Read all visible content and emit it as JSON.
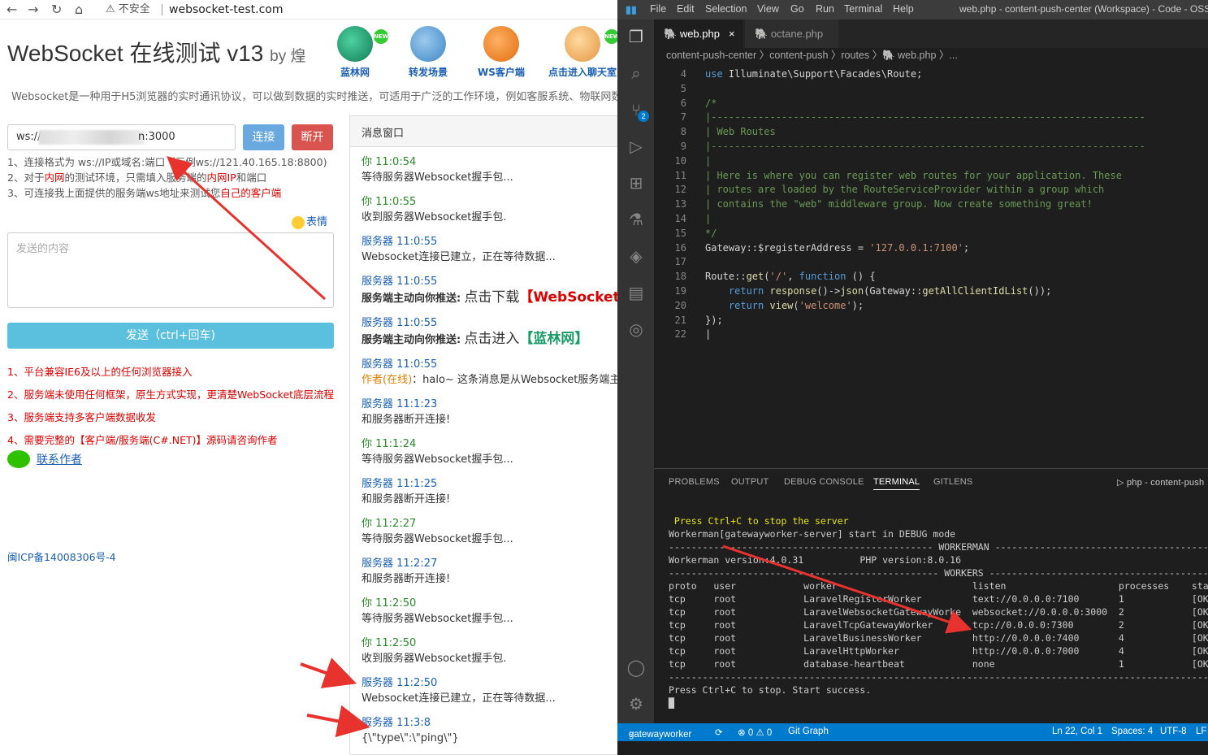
{
  "browser": {
    "warn_label": "不安全",
    "url": "websocket-test.com"
  },
  "page": {
    "title": "WebSocket 在线测试 v13",
    "by": "by 煌",
    "nav": [
      {
        "label": "蓝林网",
        "color": "#1a9c6a"
      },
      {
        "label": "转发场景",
        "color": "#5a9fd4"
      },
      {
        "label": "WS客户端",
        "color": "#f08c2c"
      },
      {
        "label": "点击进入聊天室",
        "color": "#f5c46a"
      }
    ],
    "badge": "NEW",
    "intro": "Websocket是一种用于H5浏览器的实时通讯协议，可以做到数据的实时推送，可适用于广泛的工作环境，例如客服系统、物联网数",
    "ws_prefix": "ws://",
    "ws_suffix": "n:3000",
    "connect_label": "连接",
    "disconnect_label": "断开",
    "tips": {
      "t1": "1、连接格式为 ws://IP或域名:端口（示例ws://121.40.165.18:8800)",
      "t2a": "2、对于",
      "t2b": "内网",
      "t2c": "的测试环境，只需填入服务端的",
      "t2d": "内网IP",
      "t2e": "和端口",
      "t3a": "3、可连接我上面提供的服务端ws地址来测试您",
      "t3b": "自己的客户端"
    },
    "emoji_label": "表情",
    "textarea_placeholder": "发送的内容",
    "send_label": "发送（ctrl+回车)",
    "features": [
      "1、平台兼容IE6及以上的任何浏览器接入",
      "2、服务端未使用任何框架，原生方式实现，更清楚WebSocket底层流程",
      "3、服务端支持多客户端数据收发",
      "4、需要完整的【客户端/服务端(C#.NET)】源码请咨询作者"
    ],
    "contact_label": "联系作者",
    "icp": "闽ICP备14008306号-4"
  },
  "messages": {
    "header": "消息窗口",
    "items": [
      {
        "who": "你",
        "time": "11:0:54",
        "kind": "you",
        "text": "等待服务器Websocket握手包..."
      },
      {
        "who": "你",
        "time": "11:0:55",
        "kind": "you",
        "text": "收到服务器Websocket握手包."
      },
      {
        "who": "服务器",
        "time": "11:0:55",
        "kind": "srv",
        "text": "Websocket连接已建立，正在等待数据..."
      },
      {
        "who": "服务器",
        "time": "11:0:55",
        "kind": "srv",
        "push": "服务端主动向你推送:",
        "pushbig": "点击下载",
        "pushred": "【WebSocket"
      },
      {
        "who": "服务器",
        "time": "11:0:55",
        "kind": "srv",
        "push": "服务端主动向你推送:",
        "pushbig": "点击进入",
        "pushgreen": "【蓝林网】"
      },
      {
        "who": "服务器",
        "time": "11:0:55",
        "kind": "srv",
        "auth": "作者(在线)",
        "text": "：halo~ 这条消息是从Websocket服务端主动"
      },
      {
        "who": "服务器",
        "time": "11:1:23",
        "kind": "srv",
        "text": "和服务器断开连接!"
      },
      {
        "who": "你",
        "time": "11:1:24",
        "kind": "you",
        "text": "等待服务器Websocket握手包..."
      },
      {
        "who": "服务器",
        "time": "11:1:25",
        "kind": "srv",
        "text": "和服务器断开连接!"
      },
      {
        "who": "你",
        "time": "11:2:27",
        "kind": "you",
        "text": "等待服务器Websocket握手包..."
      },
      {
        "who": "服务器",
        "time": "11:2:27",
        "kind": "srv",
        "text": "和服务器断开连接!"
      },
      {
        "who": "你",
        "time": "11:2:50",
        "kind": "you",
        "text": "等待服务器Websocket握手包..."
      },
      {
        "who": "你",
        "time": "11:2:50",
        "kind": "you",
        "text": "收到服务器Websocket握手包."
      },
      {
        "who": "服务器",
        "time": "11:2:50",
        "kind": "srv",
        "text": "Websocket连接已建立，正在等待数据..."
      },
      {
        "who": "服务器",
        "time": "11:3:8",
        "kind": "srv",
        "text": "{\\\"type\\\":\\\"ping\\\"}"
      }
    ]
  },
  "vscode": {
    "menu": [
      "File",
      "Edit",
      "Selection",
      "View",
      "Go",
      "Run",
      "Terminal",
      "Help"
    ],
    "window_title": "web.php - content-push-center (Workspace) - Code - OSS",
    "tabs": [
      {
        "label": "web.php",
        "active": true
      },
      {
        "label": "octane.php",
        "active": false
      }
    ],
    "tab_close": "×",
    "breadcrumb": "content-push-center 〉content-push 〉routes 〉🐘 web.php 〉...",
    "scm_badge": "2",
    "lines": [
      {
        "n": "4",
        "html": "<span class='kw'>use</span> Illuminate\\Support\\Facades\\Route;"
      },
      {
        "n": "5",
        "html": ""
      },
      {
        "n": "6",
        "html": "<span class='cm'>/*</span>"
      },
      {
        "n": "7",
        "html": "<span class='cm'>|--------------------------------------------------------------------------</span>"
      },
      {
        "n": "8",
        "html": "<span class='cm'>| Web Routes</span>"
      },
      {
        "n": "9",
        "html": "<span class='cm'>|--------------------------------------------------------------------------</span>"
      },
      {
        "n": "10",
        "html": "<span class='cm'>|</span>"
      },
      {
        "n": "11",
        "html": "<span class='cm'>| Here is where you can register web routes for your application. These</span>"
      },
      {
        "n": "12",
        "html": "<span class='cm'>| routes are loaded by the RouteServiceProvider within a group which</span>"
      },
      {
        "n": "13",
        "html": "<span class='cm'>| contains the \"web\" middleware group. Now create something great!</span>"
      },
      {
        "n": "14",
        "html": "<span class='cm'>|</span>"
      },
      {
        "n": "15",
        "html": "<span class='cm'>*/</span>"
      },
      {
        "n": "16",
        "html": "Gateway::$registerAddress = <span class='st'>'127.0.0.1:7100'</span>;"
      },
      {
        "n": "17",
        "html": ""
      },
      {
        "n": "18",
        "html": "Route::<span class='fn'>get</span>(<span class='st'>'/'</span>, <span class='kw'>function</span> () {"
      },
      {
        "n": "19",
        "html": "    <span class='kw'>return</span> <span class='fn'>response</span>()-><span class='fn'>json</span>(Gateway::<span class='fn'>getAllClientIdList</span>());"
      },
      {
        "n": "20",
        "html": "    <span class='kw'>return</span> <span class='fn'>view</span>(<span class='st'>'welcome'</span>);"
      },
      {
        "n": "21",
        "html": "});"
      },
      {
        "n": "22",
        "html": "|"
      }
    ],
    "panel_tabs": [
      "PROBLEMS",
      "OUTPUT",
      "DEBUG CONSOLE",
      "TERMINAL",
      "GITLENS"
    ],
    "terminal_tab": "php - content-push",
    "terminal": [
      {
        "cls": "yel",
        "text": " Press Ctrl+C to stop the server"
      },
      {
        "cls": "",
        "text": ""
      },
      {
        "cls": "",
        "text": "Workerman[gatewayworker-server] start in DEBUG mode"
      },
      {
        "cls": "",
        "text": "----------------------------------------------- WORKERMAN -----------------------------------------"
      },
      {
        "cls": "",
        "text": "Workerman version:4.0.31          PHP version:8.0.16"
      },
      {
        "cls": "",
        "text": "------------------------------------------------ WORKERS ------------------------------------------"
      },
      {
        "cls": "",
        "text": "proto   user            worker                        listen                    processes    sta"
      },
      {
        "cls": "",
        "text": "tcp     root            LaravelRegisterWorker         text://0.0.0.0:7100       1            [OK"
      },
      {
        "cls": "",
        "text": "tcp     root            LaravelWebsocketGatewayWorke  websocket://0.0.0.0:3000  2            [OK"
      },
      {
        "cls": "",
        "text": "tcp     root            LaravelTcpGatewayWorker       tcp://0.0.0.0:7300        2            [OK"
      },
      {
        "cls": "",
        "text": "tcp     root            LaravelBusinessWorker         http://0.0.0.0:7400       4            [OK"
      },
      {
        "cls": "",
        "text": "tcp     root            LaravelHttpWorker             http://0.0.0.0:7000       4            [OK"
      },
      {
        "cls": "",
        "text": "tcp     root            database-heartbeat            none                      1            [OK"
      },
      {
        "cls": "",
        "text": "---------------------------------------------------------------------------------------------------"
      },
      {
        "cls": "",
        "text": "Press Ctrl+C to stop. Start success."
      },
      {
        "cls": "",
        "text": "█"
      }
    ],
    "status": {
      "branch": "gatewayworker",
      "errors": "⊗ 0 ⚠ 0",
      "git_graph": "Git Graph",
      "pos": "Ln 22, Col 1",
      "spaces": "Spaces: 4",
      "enc": "UTF-8",
      "eol": "LF"
    }
  }
}
